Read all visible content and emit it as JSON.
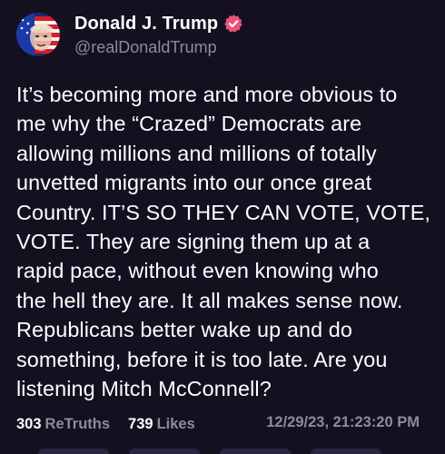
{
  "post": {
    "author": {
      "display_name": "Donald J. Trump",
      "handle": "@realDonaldTrump",
      "verified": true,
      "avatar_icon": "avatar-portrait",
      "verified_icon": "verified-badge-icon",
      "verified_color": "#e9537b"
    },
    "body": "It’s becoming more and more obvious to\nme why the “Crazed” Democrats are\nallowing millions and millions of totally\nunvetted migrants into our once great\nCountry. IT’S SO THEY CAN VOTE, VOTE,\nVOTE. They are signing them up at a\nrapid pace, without even knowing who\nthe hell they are. It all makes sense now.\nRepublicans better wake up and do\nsomething, before it is too late. Are you\nlistening Mitch McConnell?",
    "stats": {
      "retruths_count": "303",
      "retruths_label": "ReTruths",
      "likes_count": "739",
      "likes_label": "Likes"
    },
    "timestamp": "12/29/23, 21:23:20 PM"
  },
  "colors": {
    "background": "#151020",
    "text_primary": "#ffffff",
    "text_secondary": "#8f8a9c",
    "accent": "#e9537b"
  }
}
